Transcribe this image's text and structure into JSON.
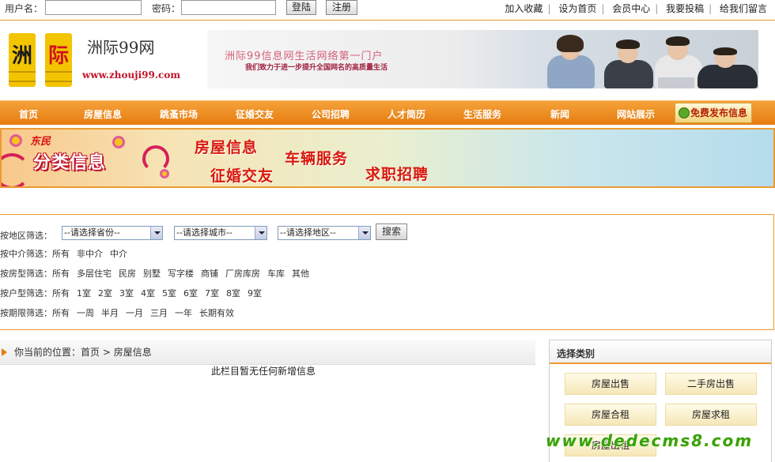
{
  "login": {
    "username_label": "用户名：",
    "password_label": "密码：",
    "username_value": "",
    "password_value": "",
    "login_button": "登陆",
    "register_button": "注册"
  },
  "top_links": [
    "加入收藏",
    "设为首页",
    "会员中心",
    "我要投稿",
    "给我们留言"
  ],
  "header": {
    "logo_chars": [
      "洲",
      "际"
    ],
    "site_name": "洲际99网",
    "site_url": "www.zhouji99.com",
    "banner_slogan": "洲际99信息网生活网络第一门户",
    "banner_subslogan": "我们致力于进一步提升全国网名的高质量生活"
  },
  "nav": {
    "items": [
      "首页",
      "房屋信息",
      "跳蚤市场",
      "征婚交友",
      "公司招聘",
      "人才简历",
      "生活服务",
      "新闻",
      "网站展示"
    ],
    "post_button": "免费发布信息"
  },
  "category_banner": {
    "small_text": "东民",
    "big_text": "分类信息",
    "categories": [
      "房屋信息",
      "车辆服务",
      "征婚交友",
      "求职招聘"
    ]
  },
  "filter": {
    "region_label": "按地区筛选：",
    "province_select": "--请选择省份--",
    "city_select": "--请选择城市--",
    "district_select": "--请选择地区--",
    "search_button": "搜索",
    "agent_label": "按中介筛选：",
    "agent_options": [
      "所有",
      "非中介",
      "中介"
    ],
    "type_label": "按房型筛选：",
    "type_options": [
      "所有",
      "多层住宅",
      "民房",
      "别墅",
      "写字楼",
      "商铺",
      "厂房库房",
      "车库",
      "其他"
    ],
    "room_label": "按户型筛选：",
    "room_options": [
      "所有",
      "1室",
      "2室",
      "3室",
      "4室",
      "5室",
      "6室",
      "7室",
      "8室",
      "9室"
    ],
    "period_label": "按期限筛选：",
    "period_options": [
      "所有",
      "一周",
      "半月",
      "一月",
      "三月",
      "一年",
      "长期有效"
    ]
  },
  "breadcrumb": {
    "prefix": "你当前的位置：",
    "home": "首页",
    "separator": ">",
    "current": "房屋信息"
  },
  "empty_message": "此栏目暂无任何新增信息",
  "sidebar": {
    "title": "选择类别",
    "buttons": [
      "房屋出售",
      "二手房出售",
      "房屋合租",
      "房屋求租",
      "房屋出租"
    ]
  },
  "watermark": "www.dedecms8.com",
  "colors": {
    "accent": "#e67c10",
    "border": "#ec9a32",
    "link": "#c0142a"
  }
}
